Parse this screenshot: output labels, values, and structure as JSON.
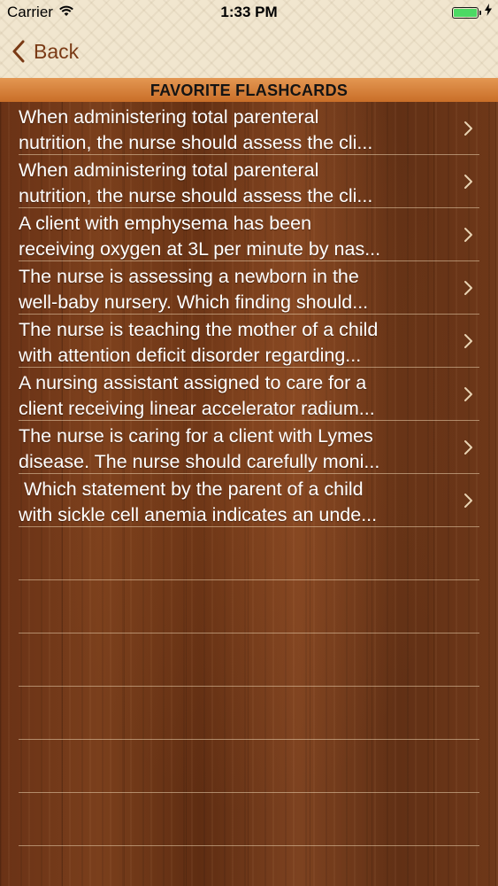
{
  "status_bar": {
    "carrier": "Carrier",
    "time": "1:33 PM",
    "battery_level": 1.0
  },
  "nav": {
    "back_label": "Back"
  },
  "section": {
    "title": "FAVORITE FLASHCARDS"
  },
  "flashcards": [
    {
      "line1": "When administering total parenteral",
      "line2": "nutrition, the nurse should assess the cli..."
    },
    {
      "line1": "When administering total parenteral",
      "line2": "nutrition, the nurse should assess the cli..."
    },
    {
      "line1": "A client with emphysema has been",
      "line2": "receiving oxygen at 3L per minute by nas..."
    },
    {
      "line1": "The nurse is assessing a newborn in the",
      "line2": "well-baby nursery. Which finding should..."
    },
    {
      "line1": "The nurse is teaching the mother of a child",
      "line2": "with attention deficit disorder regarding..."
    },
    {
      "line1": "A nursing assistant assigned to care for a",
      "line2": "client receiving linear accelerator radium..."
    },
    {
      "line1": "The nurse is caring for a client with Lymes",
      "line2": "disease. The nurse should carefully moni..."
    },
    {
      "line1": " Which statement by the parent of a child",
      "line2": "with sickle cell anemia indicates an unde..."
    }
  ],
  "colors": {
    "accent": "#7a3a15",
    "header_orange": "#d47f36",
    "wood": "#6a3517",
    "battery": "#4cd964"
  },
  "icons": {
    "wifi": "wifi-icon",
    "battery": "battery-icon",
    "charging": "charging-icon",
    "back": "chevron-left-icon",
    "row": "chevron-right-icon"
  }
}
